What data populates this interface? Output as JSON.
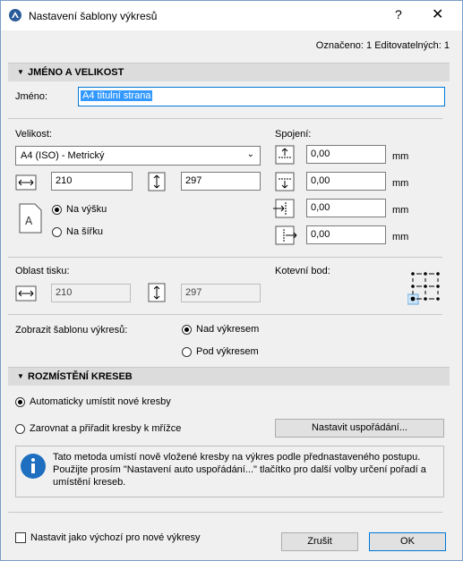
{
  "window": {
    "title": "Nastavení šablony výkresů",
    "help_label": "?",
    "close_label": "✕"
  },
  "status": "Označeno: 1 Editovatelných: 1",
  "section_name": {
    "header": "JMÉNO A VELIKOST",
    "name_label": "Jméno:",
    "name_value": "A4 titulní strana",
    "size_label": "Velikost:",
    "size_value": "A4 (ISO) - Metrický",
    "width_value": "210",
    "height_value": "297",
    "portrait_label": "Na výšku",
    "landscape_label": "Na šířku",
    "orientation_selected": "portrait",
    "margins_label": "Spojení:",
    "margins": [
      {
        "value": "0,00",
        "unit": "mm",
        "icon": "margin-top-icon"
      },
      {
        "value": "0,00",
        "unit": "mm",
        "icon": "margin-bottom-icon"
      },
      {
        "value": "0,00",
        "unit": "mm",
        "icon": "margin-left-icon"
      },
      {
        "value": "0,00",
        "unit": "mm",
        "icon": "margin-right-icon"
      }
    ],
    "print_area_label": "Oblast tisku:",
    "print_width": "210",
    "print_height": "297",
    "anchor_label": "Kotevní bod:",
    "display_label": "Zobrazit šablonu výkresů:",
    "above_label": "Nad výkresem",
    "below_label": "Pod výkresem",
    "display_selected": "above"
  },
  "section_layout": {
    "header": "ROZMÍSTĚNÍ KRESEB",
    "auto_label": "Automaticky umístit nové kresby",
    "grid_label": "Zarovnat a přiřadit kresby k mřížce",
    "selected": "auto",
    "arrange_button": "Nastavit uspořádání...",
    "info_text": "Tato metoda umístí nově vložené kresby na výkres podle přednastaveného postupu. Použijte prosím \"Nastavení auto uspořádání...\" tlačítko pro další volby určení pořadí a umístění kreseb."
  },
  "footer": {
    "default_label": "Nastavit jako výchozí pro nové výkresy",
    "default_checked": false,
    "cancel_label": "Zrušit",
    "ok_label": "OK"
  },
  "colors": {
    "accent": "#0078d7",
    "selection": "#3399ff",
    "section_bg": "#dcdcdc"
  }
}
